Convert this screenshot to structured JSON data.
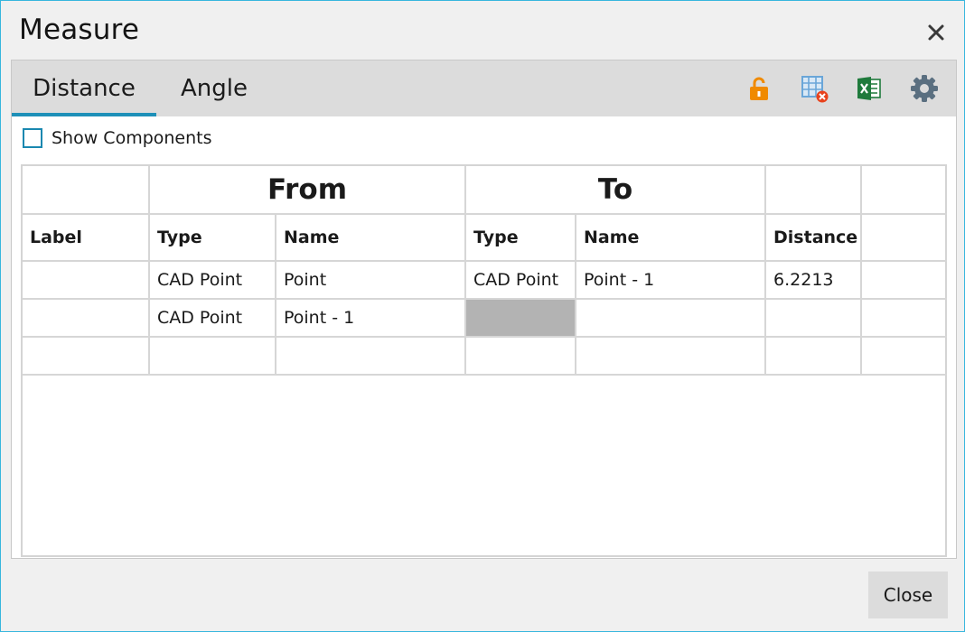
{
  "window": {
    "title": "Measure"
  },
  "tabs": [
    {
      "label": "Distance",
      "active": true
    },
    {
      "label": "Angle",
      "active": false
    }
  ],
  "toolbar": {
    "icons": [
      "unlock-icon",
      "table-delete-icon",
      "excel-export-icon",
      "settings-gear-icon"
    ],
    "colors": {
      "unlock": "#f08a00",
      "table": "#6aa6d8",
      "delete_badge": "#e8421c",
      "excel": "#1f7a3c",
      "gear": "#5a6f80"
    }
  },
  "options": {
    "show_components_label": "Show Components",
    "show_components_checked": false
  },
  "table": {
    "group_headers": [
      "",
      "From",
      "To",
      "",
      ""
    ],
    "columns": [
      "Label",
      "Type",
      "Name",
      "Type",
      "Name",
      "Distance",
      ""
    ],
    "rows": [
      [
        "",
        "CAD Point",
        "Point",
        "CAD Point",
        "Point - 1",
        "6.2213",
        ""
      ],
      [
        "",
        "CAD Point",
        "Point - 1",
        "",
        "",
        "",
        ""
      ],
      [
        "",
        "",
        "",
        "",
        "",
        "",
        ""
      ]
    ]
  },
  "footer": {
    "close_label": "Close"
  },
  "colors": {
    "accent": "#1e90b8",
    "tabbar_bg": "#dcdcdc",
    "dialog_bg": "#f0f0f0",
    "selected_cell": "#b3b3b3"
  }
}
